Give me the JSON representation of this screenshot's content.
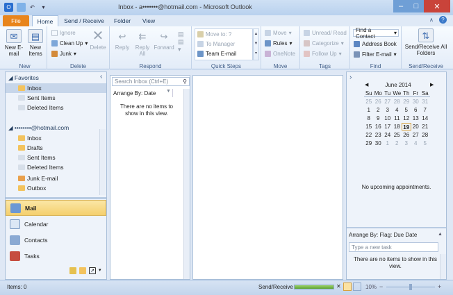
{
  "window": {
    "title": "Inbox - a•••••••@hotmail.com - Microsoft Outlook"
  },
  "tabs": {
    "file": "File",
    "home": "Home",
    "send_receive": "Send / Receive",
    "folder": "Folder",
    "view": "View"
  },
  "ribbon": {
    "new_email": "New E-mail",
    "new_items": "New Items",
    "ignore": "Ignore",
    "clean_up": "Clean Up",
    "junk": "Junk",
    "delete": "Delete",
    "reply": "Reply",
    "reply_all": "Reply All",
    "forward": "Forward",
    "group_new": "New",
    "group_delete": "Delete",
    "group_respond": "Respond",
    "move_to": "Move to: ?",
    "to_manager": "To Manager",
    "team_email": "Team E-mail",
    "group_quick_steps": "Quick Steps",
    "move": "Move",
    "rules": "Rules",
    "onenote": "OneNote",
    "group_move": "Move",
    "unread_read": "Unread/ Read",
    "categorize": "Categorize",
    "follow_up": "Follow Up",
    "group_tags": "Tags",
    "find_contact": "Find a Contact",
    "address_book": "Address Book",
    "filter_email": "Filter E-mail",
    "group_find": "Find",
    "send_receive_all": "Send/Receive All Folders",
    "group_send_receive": "Send/Receive"
  },
  "nav": {
    "favorites": "Favorites",
    "fav_items": [
      "Inbox",
      "Sent Items",
      "Deleted Items"
    ],
    "account": "••••••••@hotmail.com",
    "acct_items": [
      "Inbox",
      "Drafts",
      "Sent Items",
      "Deleted Items",
      "Junk E-mail",
      "Outbox"
    ],
    "modules": {
      "mail": "Mail",
      "calendar": "Calendar",
      "contacts": "Contacts",
      "tasks": "Tasks"
    }
  },
  "list": {
    "search_placeholder": "Search Inbox (Ctrl+E)",
    "arrange": "Arrange By: Date",
    "empty": "There are no items to show in this view."
  },
  "todo": {
    "month": "June 2014",
    "days": [
      "Su",
      "Mo",
      "Tu",
      "We",
      "Th",
      "Fr",
      "Sa"
    ],
    "weeks": [
      [
        "25",
        "26",
        "27",
        "28",
        "29",
        "30",
        "31"
      ],
      [
        "1",
        "2",
        "3",
        "4",
        "5",
        "6",
        "7"
      ],
      [
        "8",
        "9",
        "10",
        "11",
        "12",
        "13",
        "14"
      ],
      [
        "15",
        "16",
        "17",
        "18",
        "19",
        "20",
        "21"
      ],
      [
        "22",
        "23",
        "24",
        "25",
        "26",
        "27",
        "28"
      ],
      [
        "29",
        "30",
        "1",
        "2",
        "3",
        "4",
        "5"
      ]
    ],
    "today": "19",
    "no_appointments": "No upcoming appointments.",
    "arrange": "Arrange By: Flag: Due Date",
    "new_task_placeholder": "Type a new task",
    "empty": "There are no items to show in this view."
  },
  "status": {
    "items": "Items: 0",
    "send_receive": "Send/Receive",
    "zoom": "10%"
  }
}
